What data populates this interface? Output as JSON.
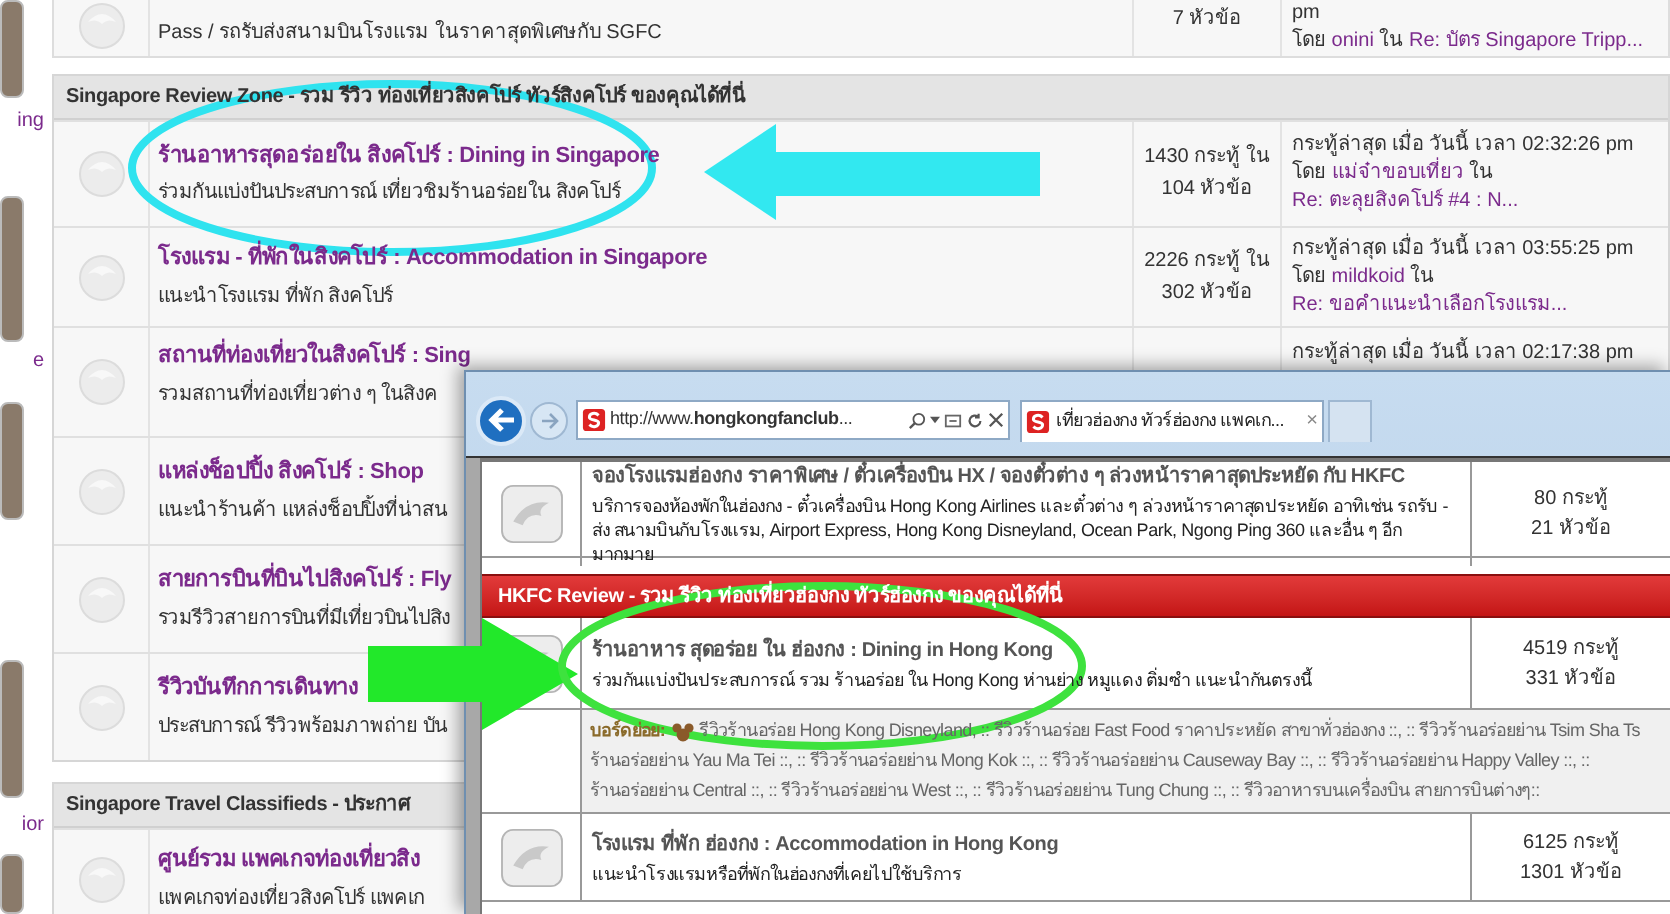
{
  "thumbnail_captions": [
    "ing",
    "e",
    "ior"
  ],
  "top_board": {
    "description": "Pass / รถรับส่งสนามบินโรงแรม ในราคาสุดพิเศษกับ SGFC",
    "stats": [
      "7 หัวข้อ"
    ],
    "last_post": {
      "time": "pm",
      "by": "โดย",
      "user": "onini",
      "in": "ใน",
      "topic": "Re: บัตร Singapore Tripp..."
    }
  },
  "sections": [
    {
      "title": "Singapore Review Zone - รวม รีวิว ท่องเที่ยวสิงคโปร์ ทัวร์สิงคโปร์ ของคุณได้ที่นี่",
      "boards": [
        {
          "title": "ร้านอาหารสุดอร่อยใน สิงคโปร์ : Dining in Singapore",
          "description": "ร่วมกันแบ่งปันประสบการณ์ เที่ยวชิมร้านอร่อยใน สิงคโปร์",
          "stats": [
            "1430 กระทู้ ใน",
            "104 หัวข้อ"
          ],
          "last_post": {
            "time": "กระทู้ล่าสุด เมื่อ วันนี้ เวลา 02:32:26 pm",
            "by": "โดย",
            "user": "แม่จ๋าขอบเที่ยว",
            "in": "ใน",
            "topic": "Re: ตะลุยสิงคโปร์ #4 : N..."
          }
        },
        {
          "title": "โรงแรม - ที่พักในสิงคโปร์ : Accommodation in Singapore",
          "description": "แนะนำโรงแรม ที่พัก สิงคโปร์",
          "stats": [
            "2226 กระทู้ ใน",
            "302 หัวข้อ"
          ],
          "last_post": {
            "time": "กระทู้ล่าสุด เมื่อ วันนี้ เวลา 03:55:25 pm",
            "by": "โดย",
            "user": "mildkoid",
            "in": "ใน",
            "topic": "Re: ขอคำแนะนำเลือกโรงแรม..."
          }
        },
        {
          "title": "สถานที่ท่องเที่ยวในสิงคโปร์ : Sing",
          "description": "รวมสถานที่ท่องเที่ยวต่าง ๆ ในสิงค",
          "last_post": {
            "time": "กระทู้ล่าสุด เมื่อ วันนี้ เวลา 02:17:38 pm"
          }
        },
        {
          "title": "แหล่งช็อปปิ้ง สิงคโปร์ : Shop",
          "description": "แนะนำร้านค้า แหล่งช็อปปิ้งที่น่าสน"
        },
        {
          "title": "สายการบินที่บินไปสิงคโปร์ : Fly",
          "description": "รวมรีวิวสายการบินที่มีเที่ยวบินไปสิง"
        },
        {
          "title": "รีวิวบันทึกการเดินทาง",
          "description": "ประสบการณ์ รีวิวพร้อมภาพถ่าย บัน"
        }
      ]
    },
    {
      "title": "Singapore Travel Classifieds - ประกาศ",
      "boards": [
        {
          "title": "ศูนย์รวม แพคเกจท่องเที่ยวสิง",
          "description": "แพคเกจท่องเที่ยวสิงคโปร์ แพคเก"
        }
      ]
    }
  ],
  "browser": {
    "address": "http://www.**hongkongfanclub**...",
    "tab": {
      "title": "เที่ยวฮ่องกง ทัวร์ฮ่องกง แพคเก...",
      "close": "×",
      "selected": true
    },
    "top_board": {
      "title": "จองโรงแรมฮ่องกง ราคาพิเศษ / ตั๋วเครื่องบิน HX / จองตั๋วต่าง ๆ ล่วงหน้าราคาสุดประหยัด กับ HKFC",
      "description": "บริการจองห้องพักในฮ่องกง - ตั๋วเครื่องบิน Hong Kong Airlines และตั๋วต่าง ๆ ล่วงหน้าราคาสุดประหยัด อาทิเช่น รถรับ - ส่ง สนามบินกับโรงแรม, Airport Express, Hong Kong Disneyland, Ocean Park, Ngong Ping 360 และอื่น ๆ อีกมากมาย",
      "stats": [
        "80 กระทู้",
        "21 หัวข้อ"
      ]
    },
    "section": {
      "title": "HKFC Review - รวม รีวิว ท่องเที่ยวฮ่องกง ทัวร์ฮ่องกง ของคุณได้ที่นี่"
    },
    "boards": [
      {
        "title": "ร้านอาหาร สุดอร่อย ใน ฮ่องกง : Dining in Hong Kong",
        "description": "ร่วมกันแบ่งปันประสบการณ์ รวม ร้านอร่อย ใน Hong Kong ห่านย่าง หมูแดง ติ่มซำ แนะนำกันตรงนี้",
        "stats": [
          "4519 กระทู้",
          "331 หัวข้อ"
        ],
        "child_boards": {
          "label": "บอร์ดย่อย:",
          "lines": [
            "รีวิวร้านอร่อย Hong Kong Disneyland, :: รีวิวร้านอร่อย Fast Food ราคาประหยัด สาขาทั่วฮ่องกง ::, :: รีวิวร้านอร่อยย่าน Tsim Sha Ts",
            "ร้านอร่อยย่าน Yau Ma Tei ::, :: รีวิวร้านอร่อยย่าน Mong Kok ::, :: รีวิวร้านอร่อยย่าน Causeway Bay ::, :: รีวิวร้านอร่อยย่าน Happy Valley ::, ::",
            "ร้านอร่อยย่าน Central ::, :: รีวิวร้านอร่อยย่าน West ::, :: รีวิวร้านอร่อยย่าน Tung Chung ::, :: รีวิวอาหารบนเครื่องบิน สายการบินต่างๆ::"
          ]
        }
      },
      {
        "title": "โรงแรม ที่พัก ฮ่องกง : Accommodation in Hong Kong",
        "description": "แนะนำโรงแรมหรือที่พักในฮ่องกงที่เคยไปใช้บริการ",
        "stats": [
          "6125 กระทู้",
          "1301 หัวข้อ"
        ]
      }
    ]
  }
}
